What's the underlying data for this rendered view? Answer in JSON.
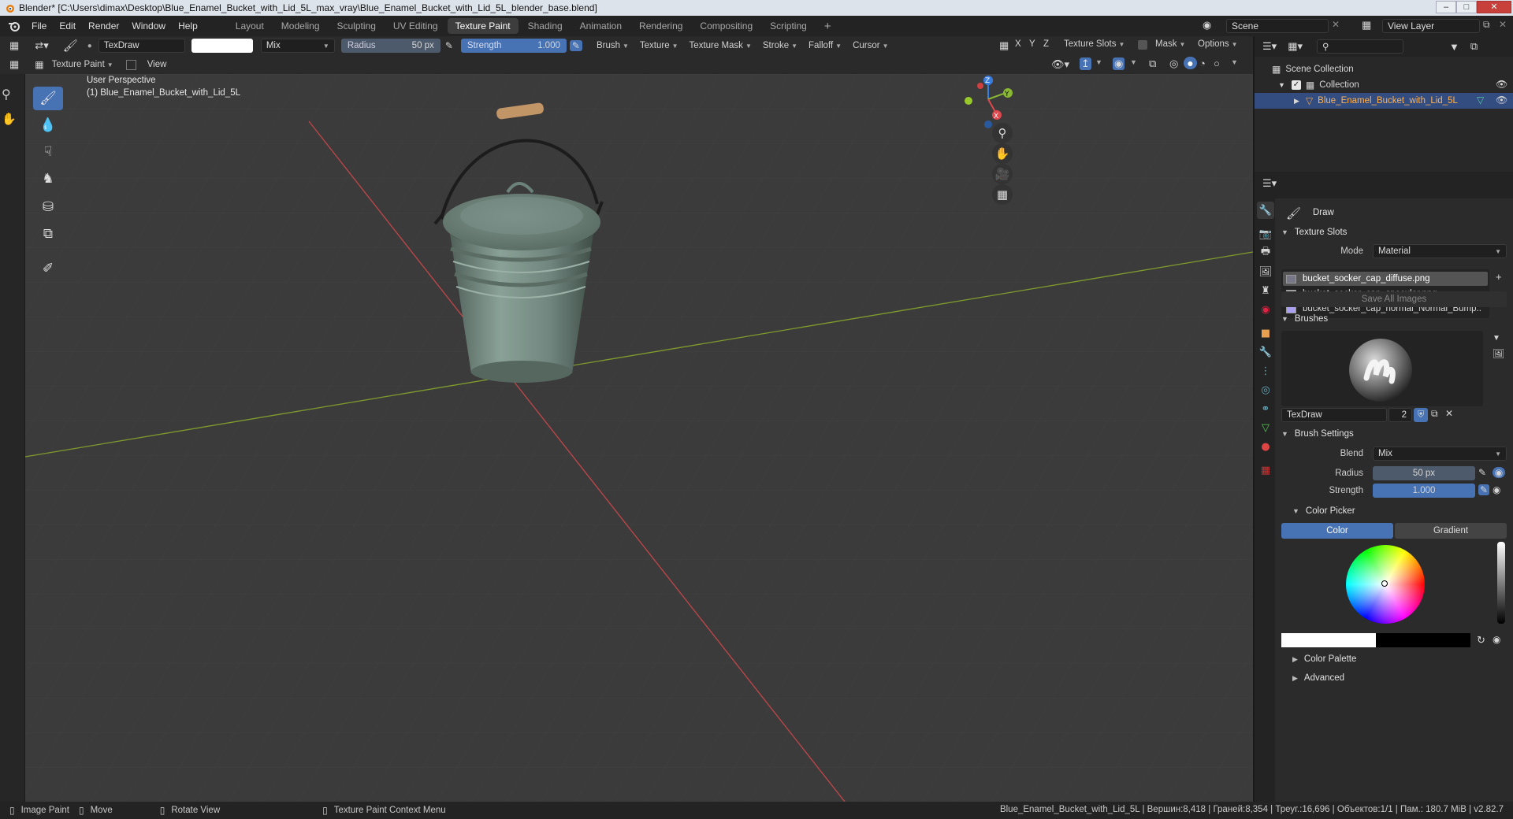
{
  "window": {
    "title": "Blender* [C:\\Users\\dimax\\Desktop\\Blue_Enamel_Bucket_with_Lid_5L_max_vray\\Blue_Enamel_Bucket_with_Lid_5L_blender_base.blend]",
    "minimize": "–",
    "maximize": "□",
    "close": "✕"
  },
  "menu": [
    "File",
    "Edit",
    "Render",
    "Window",
    "Help"
  ],
  "workspaces": [
    "Layout",
    "Modeling",
    "Sculpting",
    "UV Editing",
    "Texture Paint",
    "Shading",
    "Animation",
    "Rendering",
    "Compositing",
    "Scripting"
  ],
  "workspace_add": "+",
  "scene": {
    "name": "Scene",
    "view_layer": "View Layer"
  },
  "tool_header": {
    "brush_name": "TexDraw",
    "blend": "Mix",
    "radius_label": "Radius",
    "radius_value": "50 px",
    "strength_label": "Strength",
    "strength_value": "1.000",
    "menus": [
      "Brush",
      "Texture",
      "Texture Mask",
      "Stroke",
      "Falloff",
      "Cursor"
    ],
    "axes": [
      "X",
      "Y",
      "Z"
    ],
    "texture_slots": "Texture Slots",
    "mask": "Mask",
    "options": "Options"
  },
  "view_header": {
    "mode": "Texture Paint",
    "view": "View"
  },
  "viewport": {
    "perspective": "User Perspective",
    "object_label": "(1) Blue_Enamel_Bucket_with_Lid_5L",
    "gizmo": {
      "x": "X",
      "y": "Y",
      "z": "Z"
    }
  },
  "outliner": {
    "scene_collection": "Scene Collection",
    "collection": "Collection",
    "object": "Blue_Enamel_Bucket_with_Lid_5L"
  },
  "properties": {
    "tool_name": "Draw",
    "texture_slots": {
      "title": "Texture Slots",
      "mode_label": "Mode",
      "mode_value": "Material",
      "slots": [
        "bucket_socker_cap_diffuse.png",
        "bucket_socker_cap_specular.png",
        "bucket_socker_cap_normal_Normal_Bump.."
      ],
      "save_all": "Save All Images"
    },
    "brushes": {
      "title": "Brushes",
      "brush_name": "TexDraw",
      "users": "2"
    },
    "brush_settings": {
      "title": "Brush Settings",
      "blend_label": "Blend",
      "blend_value": "Mix",
      "radius_label": "Radius",
      "radius_value": "50 px",
      "strength_label": "Strength",
      "strength_value": "1.000"
    },
    "color_picker": {
      "title": "Color Picker",
      "color_tab": "Color",
      "gradient_tab": "Gradient"
    },
    "color_palette": "Color Palette",
    "advanced": "Advanced"
  },
  "status": {
    "left1": "Image Paint",
    "left2": "Move",
    "left3": "Rotate View",
    "left4": "Texture Paint Context Menu",
    "right": "Blue_Enamel_Bucket_with_Lid_5L | Вершин:8,418 | Граней:8,354 | Треуг.:16,696 | Объектов:1/1 | Пам.: 180.7 MiB | v2.82.7"
  },
  "colors": {
    "accent": "#4772b3",
    "viewport_bg": "#3b3b3b",
    "bucket": "#6f857d",
    "x_axis": "#c2464a",
    "y_axis": "#7f9c2d"
  }
}
